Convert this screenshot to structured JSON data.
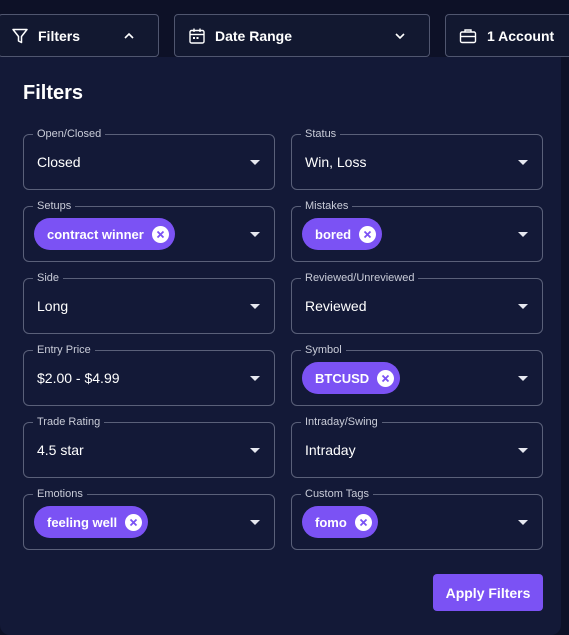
{
  "topbar": {
    "filters_label": "Filters",
    "date_range_label": "Date Range",
    "account_label": "1 Account"
  },
  "panel": {
    "title": "Filters",
    "fields": {
      "open_closed": {
        "label": "Open/Closed",
        "value": "Closed"
      },
      "status": {
        "label": "Status",
        "value": "Win, Loss"
      },
      "setups": {
        "label": "Setups",
        "chips": [
          "contract winner"
        ]
      },
      "mistakes": {
        "label": "Mistakes",
        "chips": [
          "bored"
        ]
      },
      "side": {
        "label": "Side",
        "value": "Long"
      },
      "reviewed": {
        "label": "Reviewed/Unreviewed",
        "value": "Reviewed"
      },
      "entry_price": {
        "label": "Entry Price",
        "value": "$2.00 - $4.99"
      },
      "symbol": {
        "label": "Symbol",
        "chips": [
          "BTCUSD"
        ]
      },
      "trade_rating": {
        "label": "Trade Rating",
        "value": "4.5 star"
      },
      "intraday_swing": {
        "label": "Intraday/Swing",
        "value": "Intraday"
      },
      "emotions": {
        "label": "Emotions",
        "chips": [
          "feeling well"
        ]
      },
      "custom_tags": {
        "label": "Custom Tags",
        "chips": [
          "fomo"
        ]
      }
    },
    "apply_label": "Apply Filters"
  },
  "colors": {
    "background": "#0d1127",
    "panel": "#131937",
    "accent": "#7b52f4",
    "border": "#5a6079"
  },
  "icons": {
    "filters": "funnel-icon",
    "date_range": "calendar-icon",
    "account": "briefcase-icon"
  }
}
